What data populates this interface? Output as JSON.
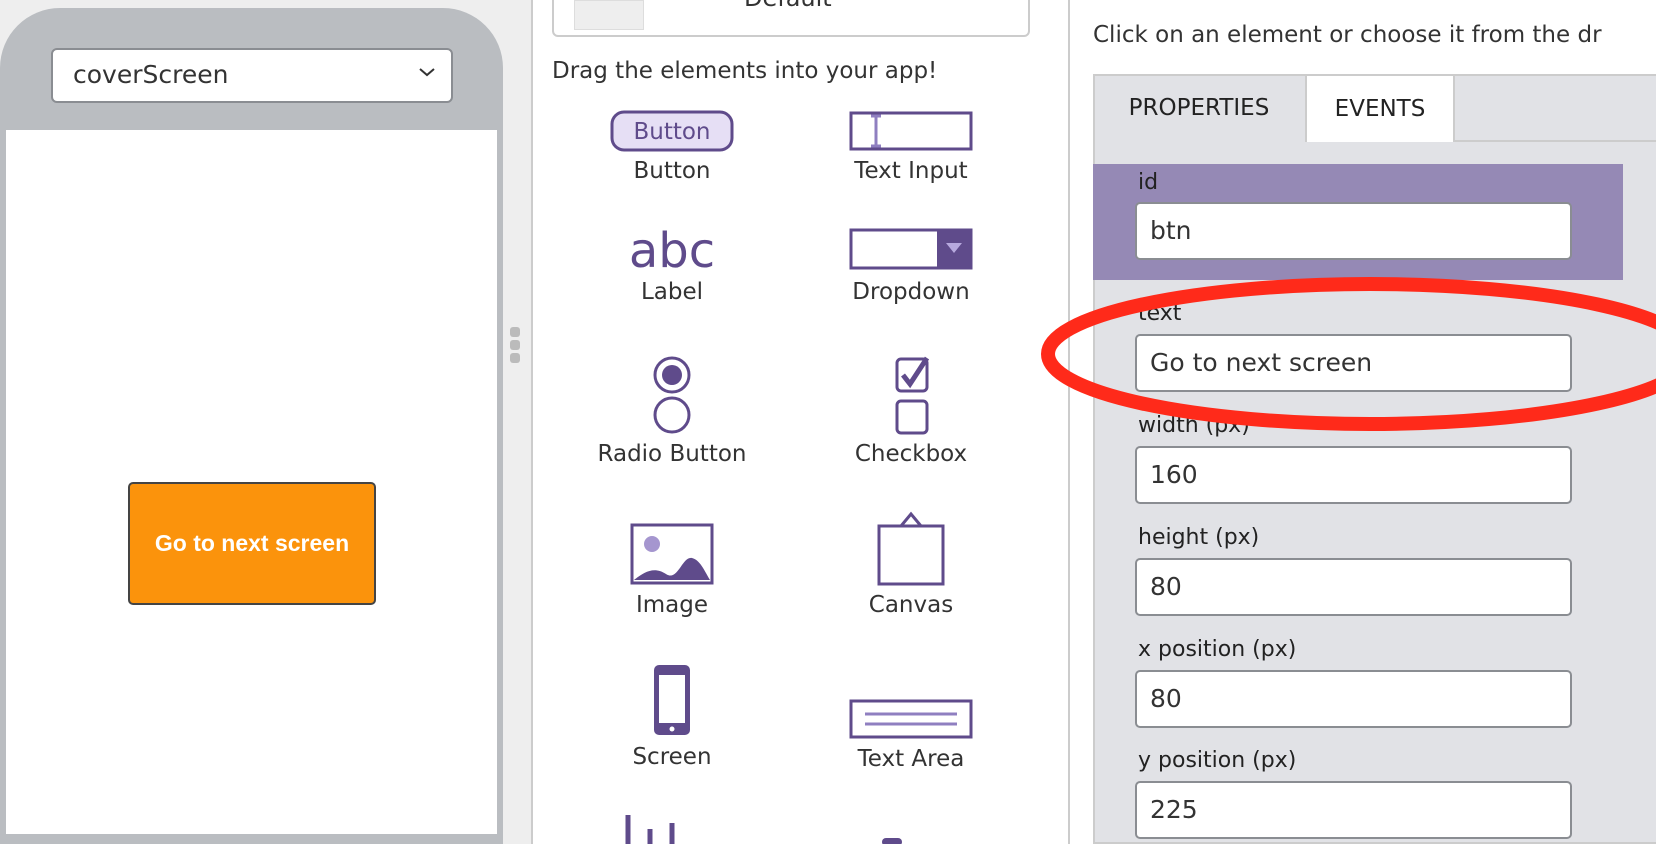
{
  "phone": {
    "screen_select": "coverScreen",
    "app_button_text": "Go to next screen"
  },
  "toolbox": {
    "theme_default": "Default",
    "hint": "Drag the elements into your app!",
    "button_icon_text": "Button",
    "items": [
      {
        "label": "Button",
        "icon": "button-icon"
      },
      {
        "label": "Text Input",
        "icon": "text-input-icon"
      },
      {
        "label": "Label",
        "icon": "label-icon",
        "icon_text": "abc"
      },
      {
        "label": "Dropdown",
        "icon": "dropdown-icon"
      },
      {
        "label": "Radio Button",
        "icon": "radio-button-icon"
      },
      {
        "label": "Checkbox",
        "icon": "checkbox-icon"
      },
      {
        "label": "Image",
        "icon": "image-icon"
      },
      {
        "label": "Canvas",
        "icon": "canvas-icon"
      },
      {
        "label": "Screen",
        "icon": "screen-icon"
      },
      {
        "label": "Text Area",
        "icon": "text-area-icon"
      }
    ]
  },
  "properties": {
    "instruction": "Click on an element or choose it from the dr",
    "tabs": [
      "PROPERTIES",
      "EVENTS"
    ],
    "fields": [
      {
        "label": "id",
        "value": "btn"
      },
      {
        "label": "text",
        "value": "Go to next screen"
      },
      {
        "label": "width (px)",
        "value": "160"
      },
      {
        "label": "height (px)",
        "value": "80"
      },
      {
        "label": "x position (px)",
        "value": "80"
      },
      {
        "label": "y position (px)",
        "value": "225"
      }
    ]
  },
  "colors": {
    "accent": "#5f4b8b",
    "app_button": "#fb930c",
    "highlight": "#ff2a1a"
  }
}
